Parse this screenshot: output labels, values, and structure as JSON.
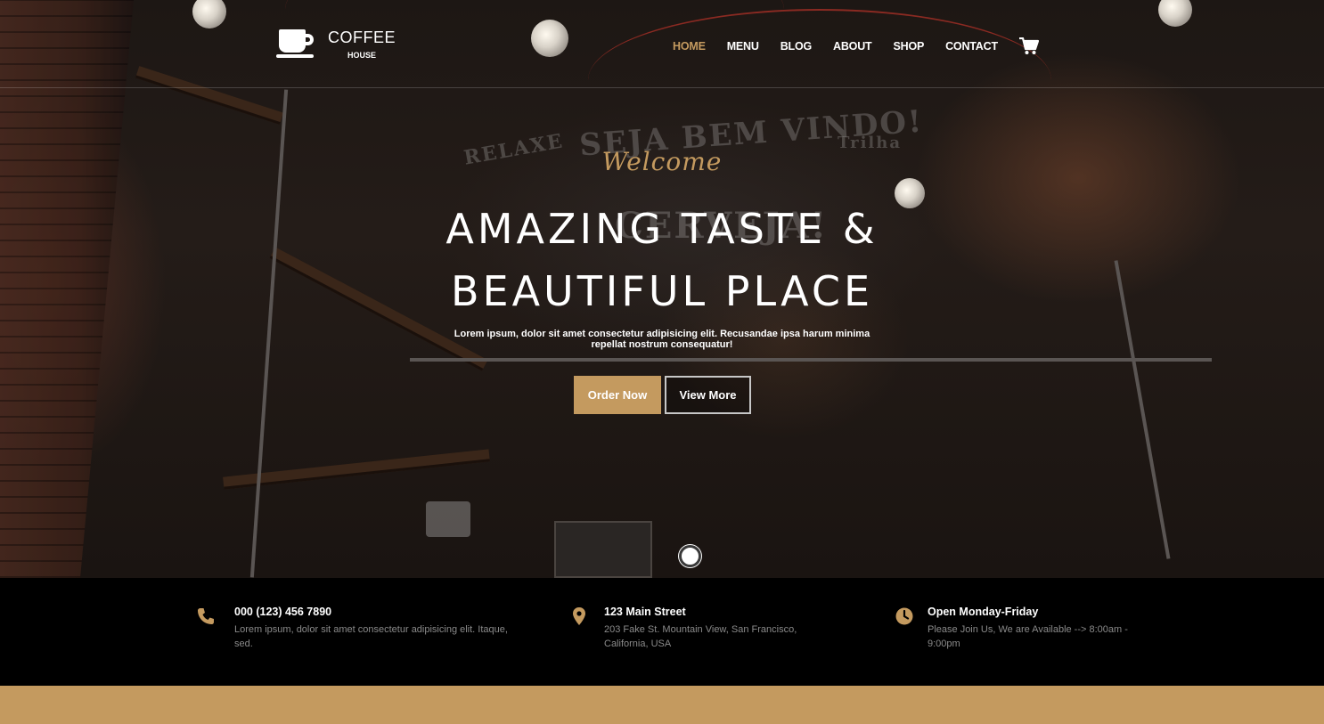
{
  "brand": {
    "title": "COFFEE",
    "subtitle": "HOUSE",
    "accent_color": "#c49a5f"
  },
  "nav": {
    "items": [
      {
        "label": "HOME",
        "active": true
      },
      {
        "label": "MENU",
        "active": false
      },
      {
        "label": "BLOG",
        "active": false
      },
      {
        "label": "ABOUT",
        "active": false
      },
      {
        "label": "SHOP",
        "active": false
      },
      {
        "label": "CONTACT",
        "active": false
      }
    ],
    "cart_icon": "cart-icon"
  },
  "hero": {
    "welcome": "Welcome",
    "headline_line1": "AMAZING TASTE &",
    "headline_line2": "BEAUTIFUL PLACE",
    "lead": "Lorem ipsum, dolor sit amet consectetur adipisicing elit. Recusandae ipsa harum minima repellat nostrum consequatur!",
    "primary_button": "Order Now",
    "secondary_button": "View More"
  },
  "info": [
    {
      "icon": "phone-icon",
      "title": "000 (123) 456 7890",
      "desc": "Lorem ipsum, dolor sit amet consectetur adipisicing elit. Itaque, sed."
    },
    {
      "icon": "map-pin-icon",
      "title": "123 Main Street",
      "desc": "203 Fake St. Mountain View, San Francisco, California, USA"
    },
    {
      "icon": "clock-icon",
      "title": "Open Monday-Friday",
      "desc": "Please Join Us, We are Available --> 8:00am - 9:00pm"
    }
  ]
}
